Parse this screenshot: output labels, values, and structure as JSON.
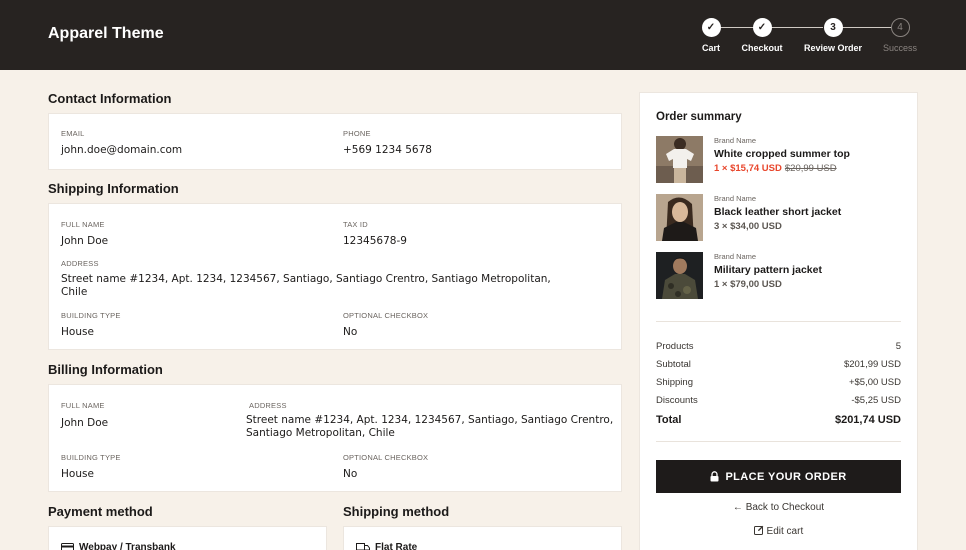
{
  "header": {
    "brand": "Apparel Theme",
    "steps": [
      {
        "label": "Cart",
        "mark": "✓",
        "state": "done"
      },
      {
        "label": "Checkout",
        "mark": "✓",
        "state": "done"
      },
      {
        "label": "Review Order",
        "mark": "3",
        "state": "active"
      },
      {
        "label": "Success",
        "mark": "4",
        "state": "todo"
      }
    ]
  },
  "contact": {
    "title": "Contact Information",
    "email_label": "EMAIL",
    "email": "john.doe@domain.com",
    "phone_label": "PHONE",
    "phone": "+569 1234 5678"
  },
  "shipping_info": {
    "title": "Shipping Information",
    "full_name_label": "FULL NAME",
    "full_name": "John Doe",
    "tax_id_label": "TAX ID",
    "tax_id": "12345678-9",
    "address_label": "ADDRESS",
    "address_line1": "Street name #1234, Apt. 1234, 1234567, Santiago, Santiago Crentro, Santiago Metropolitan,",
    "address_line2": "Chile",
    "building_type_label": "BUILDING TYPE",
    "building_type": "House",
    "optional_checkbox_label": "OPTIONAL CHECKBOX",
    "optional_checkbox": "No"
  },
  "billing_info": {
    "title": "Billing Information",
    "full_name_label": "FULL NAME",
    "full_name": "John Doe",
    "address_label": "ADDRESS",
    "address_line1": "Street name #1234, Apt. 1234, 1234567, Santiago, Santiago Crentro,",
    "address_line2": "Santiago Metropolitan, Chile",
    "building_type_label": "BUILDING TYPE",
    "building_type": "House",
    "optional_checkbox_label": "OPTIONAL CHECKBOX",
    "optional_checkbox": "No"
  },
  "payment": {
    "title": "Payment method",
    "option": "Webpay / Transbank",
    "icon": "credit-card-icon"
  },
  "shipping_method": {
    "title": "Shipping method",
    "option": "Flat Rate",
    "icon": "truck-icon"
  },
  "summary": {
    "title": "Order summary",
    "items": [
      {
        "brand": "Brand Name",
        "name": "White cropped summer top",
        "price": "1 × $15,74 USD",
        "old_price": "$20,99 USD",
        "on_sale": true
      },
      {
        "brand": "Brand Name",
        "name": "Black leather short jacket",
        "price": "3 × $34,00 USD",
        "old_price": "",
        "on_sale": false
      },
      {
        "brand": "Brand Name",
        "name": "Military pattern jacket",
        "price": "1 × $79,00 USD",
        "old_price": "",
        "on_sale": false
      }
    ],
    "products_label": "Products",
    "products_value": "5",
    "subtotal_label": "Subtotal",
    "subtotal_value": "$201,99 USD",
    "shipping_label": "Shipping",
    "shipping_value": "+$5,00 USD",
    "discounts_label": "Discounts",
    "discounts_value": "-$5,25 USD",
    "total_label": "Total",
    "total_value": "$201,74 USD",
    "place_order_label": "PLACE YOUR ORDER",
    "back_label": "Back to Checkout",
    "edit_label": "Edit cart"
  },
  "colors": {
    "header_bg": "#272321",
    "page_bg": "#f7f1e9",
    "sale": "#e8462c",
    "button_bg": "#1e1b1a"
  }
}
